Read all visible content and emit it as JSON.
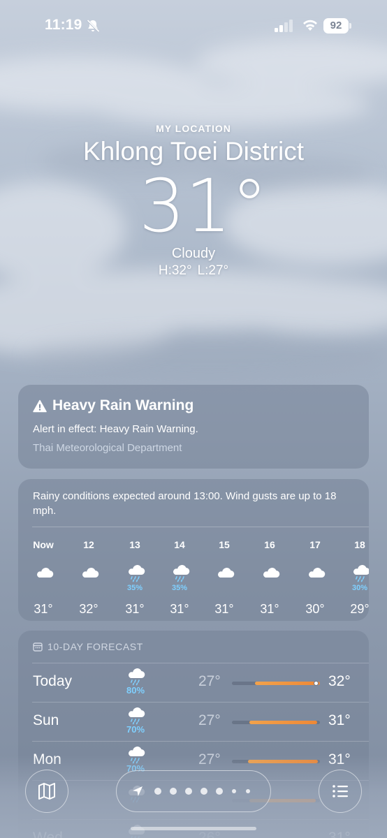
{
  "status_bar": {
    "time": "11:19",
    "battery": "92",
    "icons": [
      "bell-slash-icon",
      "cellular-signal-icon",
      "wifi-icon",
      "battery-icon"
    ]
  },
  "location": {
    "label": "MY LOCATION",
    "name": "Khlong Toei District",
    "temperature": "31°",
    "condition": "Cloudy",
    "high": "H:32°",
    "low": "L:27°"
  },
  "alert": {
    "title": "Heavy Rain Warning",
    "description": "Alert in effect: Heavy Rain Warning.",
    "source": "Thai Meteorological Department",
    "icon": "warning-triangle-icon"
  },
  "hourly": {
    "summary": "Rainy conditions expected around 13:00. Wind gusts are up to 18 mph.",
    "hours": [
      {
        "label": "Now",
        "icon": "cloud-icon",
        "pct": "",
        "temp": "31°"
      },
      {
        "label": "12",
        "icon": "cloud-icon",
        "pct": "",
        "temp": "32°"
      },
      {
        "label": "13",
        "icon": "cloud-rain-icon",
        "pct": "35%",
        "temp": "31°"
      },
      {
        "label": "14",
        "icon": "cloud-rain-icon",
        "pct": "35%",
        "temp": "31°"
      },
      {
        "label": "15",
        "icon": "cloud-icon",
        "pct": "",
        "temp": "31°"
      },
      {
        "label": "16",
        "icon": "cloud-icon",
        "pct": "",
        "temp": "31°"
      },
      {
        "label": "17",
        "icon": "cloud-icon",
        "pct": "",
        "temp": "30°"
      },
      {
        "label": "18",
        "icon": "cloud-rain-icon",
        "pct": "30%",
        "temp": "29°"
      }
    ]
  },
  "forecast": {
    "header": "10-DAY FORECAST",
    "days": [
      {
        "name": "Today",
        "icon": "cloud-rain-icon",
        "pct": "80%",
        "low": "27°",
        "high": "32°",
        "bar_start": 0.26,
        "bar_end": 1.0,
        "current": 0.96
      },
      {
        "name": "Sun",
        "icon": "cloud-rain-icon",
        "pct": "70%",
        "low": "27°",
        "high": "31°",
        "bar_start": 0.2,
        "bar_end": 0.97
      },
      {
        "name": "Mon",
        "icon": "cloud-rain-icon",
        "pct": "70%",
        "low": "27°",
        "high": "31°",
        "bar_start": 0.18,
        "bar_end": 0.98
      },
      {
        "name": "",
        "icon": "cloud-rain-icon",
        "pct": "",
        "low": "",
        "high": "",
        "bar_start": 0.2,
        "bar_end": 0.95
      },
      {
        "name": "Wed",
        "icon": "cloud-rain-icon",
        "pct": "",
        "low": "26°",
        "high": "31°",
        "bar_start": 0.15,
        "bar_end": 0.95
      }
    ]
  },
  "bottom_bar": {
    "map_icon": "map-icon",
    "list_icon": "list-icon",
    "location_arrow_icon": "location-arrow-icon",
    "page_count": 7
  }
}
